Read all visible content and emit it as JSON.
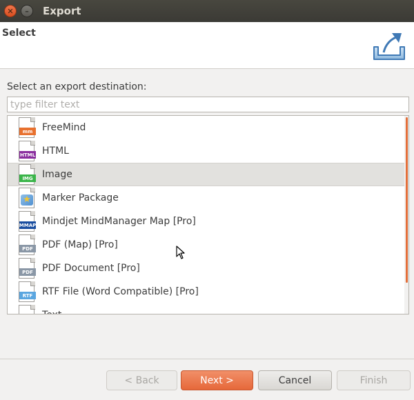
{
  "window": {
    "title": "Export",
    "close_glyph": "✕",
    "minimize_glyph": "–"
  },
  "header": {
    "title": "Select",
    "icon": "export-tray-icon"
  },
  "content": {
    "destination_label": "Select an export destination:",
    "filter_placeholder": "type filter text",
    "filter_value": ""
  },
  "list": {
    "selected_index": 2,
    "items": [
      {
        "label": "FreeMind",
        "tag": "mm",
        "tag_color": "#e8712f",
        "icon": "freemind-file-icon"
      },
      {
        "label": "HTML",
        "tag": "HTML",
        "tag_color": "#8a2d9e",
        "icon": "html-file-icon"
      },
      {
        "label": "Image",
        "tag": "IMG",
        "tag_color": "#3bb54a",
        "icon": "image-file-icon"
      },
      {
        "label": "Marker Package",
        "tag": "★",
        "tag_color": "#4f8fd0",
        "icon": "marker-package-icon"
      },
      {
        "label": "Mindjet MindManager Map [Pro]",
        "tag": "MMAP",
        "tag_color": "#1a4ea0",
        "icon": "mindmanager-file-icon"
      },
      {
        "label": "PDF (Map) [Pro]",
        "tag": "PDF",
        "tag_color": "#8a97a6",
        "icon": "pdf-map-file-icon"
      },
      {
        "label": "PDF Document [Pro]",
        "tag": "PDF",
        "tag_color": "#8a97a6",
        "icon": "pdf-document-file-icon"
      },
      {
        "label": "RTF File (Word Compatible) [Pro]",
        "tag": "RTF",
        "tag_color": "#5aa6e0",
        "icon": "rtf-file-icon"
      },
      {
        "label": "Text",
        "tag": "",
        "tag_color": "#8a97a6",
        "icon": "text-file-icon"
      }
    ]
  },
  "buttons": {
    "back": "< Back",
    "next": "Next >",
    "cancel": "Cancel",
    "finish": "Finish"
  },
  "colors": {
    "accent": "#e6683a",
    "scroll_thumb": "#e36f3a"
  }
}
